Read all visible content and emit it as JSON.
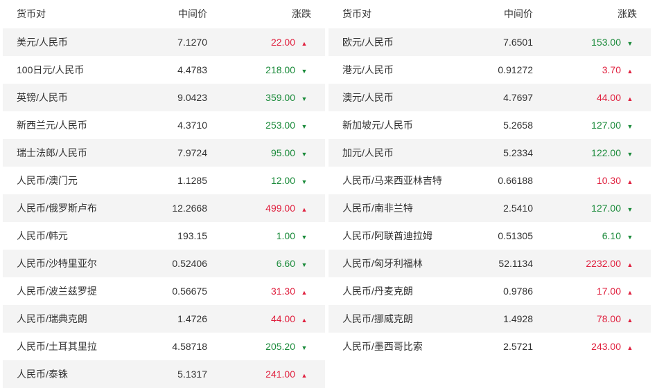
{
  "headers": {
    "pair": "货币对",
    "mid": "中间价",
    "change": "涨跌"
  },
  "colors": {
    "up": "#e0213f",
    "down": "#1a8a3a",
    "row_shade": "#f4f4f4"
  },
  "left": [
    {
      "pair": "美元/人民币",
      "mid": "7.1270",
      "change": "22.00",
      "dir": "up"
    },
    {
      "pair": "100日元/人民币",
      "mid": "4.4783",
      "change": "218.00",
      "dir": "down"
    },
    {
      "pair": "英镑/人民币",
      "mid": "9.0423",
      "change": "359.00",
      "dir": "down"
    },
    {
      "pair": "新西兰元/人民币",
      "mid": "4.3710",
      "change": "253.00",
      "dir": "down"
    },
    {
      "pair": "瑞士法郎/人民币",
      "mid": "7.9724",
      "change": "95.00",
      "dir": "down"
    },
    {
      "pair": "人民币/澳门元",
      "mid": "1.1285",
      "change": "12.00",
      "dir": "down"
    },
    {
      "pair": "人民币/俄罗斯卢布",
      "mid": "12.2668",
      "change": "499.00",
      "dir": "up"
    },
    {
      "pair": "人民币/韩元",
      "mid": "193.15",
      "change": "1.00",
      "dir": "down"
    },
    {
      "pair": "人民币/沙特里亚尔",
      "mid": "0.52406",
      "change": "6.60",
      "dir": "down"
    },
    {
      "pair": "人民币/波兰兹罗提",
      "mid": "0.56675",
      "change": "31.30",
      "dir": "up"
    },
    {
      "pair": "人民币/瑞典克朗",
      "mid": "1.4726",
      "change": "44.00",
      "dir": "up"
    },
    {
      "pair": "人民币/土耳其里拉",
      "mid": "4.58718",
      "change": "205.20",
      "dir": "down"
    },
    {
      "pair": "人民币/泰铢",
      "mid": "5.1317",
      "change": "241.00",
      "dir": "up"
    }
  ],
  "right": [
    {
      "pair": "欧元/人民币",
      "mid": "7.6501",
      "change": "153.00",
      "dir": "down"
    },
    {
      "pair": "港元/人民币",
      "mid": "0.91272",
      "change": "3.70",
      "dir": "up"
    },
    {
      "pair": "澳元/人民币",
      "mid": "4.7697",
      "change": "44.00",
      "dir": "up"
    },
    {
      "pair": "新加坡元/人民币",
      "mid": "5.2658",
      "change": "127.00",
      "dir": "down"
    },
    {
      "pair": "加元/人民币",
      "mid": "5.2334",
      "change": "122.00",
      "dir": "down"
    },
    {
      "pair": "人民币/马来西亚林吉特",
      "mid": "0.66188",
      "change": "10.30",
      "dir": "up"
    },
    {
      "pair": "人民币/南非兰特",
      "mid": "2.5410",
      "change": "127.00",
      "dir": "down"
    },
    {
      "pair": "人民币/阿联酋迪拉姆",
      "mid": "0.51305",
      "change": "6.10",
      "dir": "down"
    },
    {
      "pair": "人民币/匈牙利福林",
      "mid": "52.1134",
      "change": "2232.00",
      "dir": "up"
    },
    {
      "pair": "人民币/丹麦克朗",
      "mid": "0.9786",
      "change": "17.00",
      "dir": "up"
    },
    {
      "pair": "人民币/挪威克朗",
      "mid": "1.4928",
      "change": "78.00",
      "dir": "up"
    },
    {
      "pair": "人民币/墨西哥比索",
      "mid": "2.5721",
      "change": "243.00",
      "dir": "up"
    }
  ]
}
